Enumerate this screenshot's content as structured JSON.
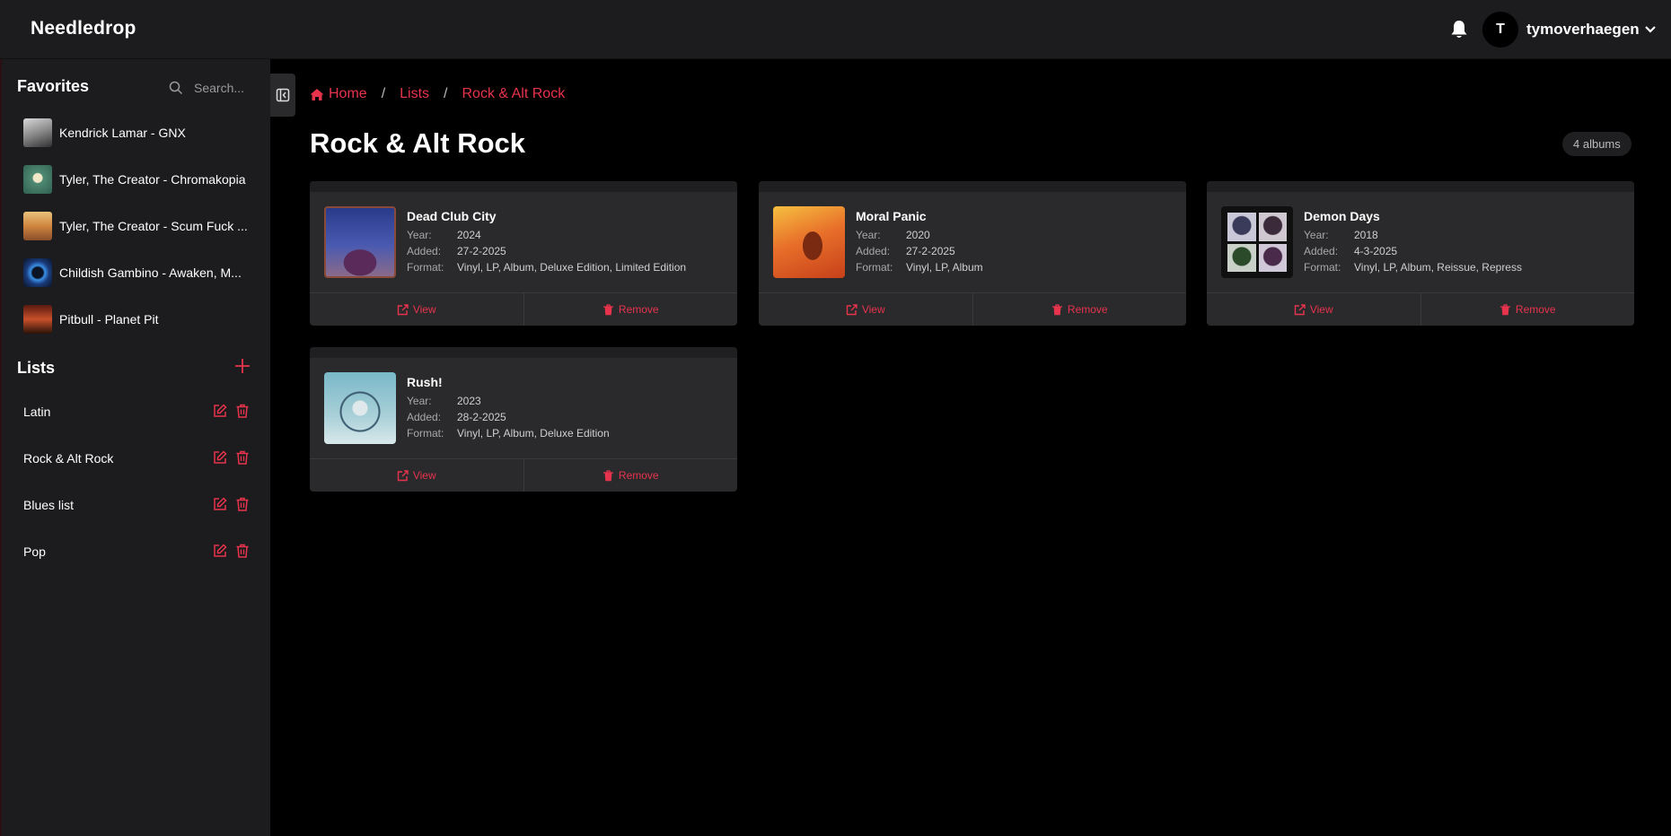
{
  "app": {
    "name": "Needledrop"
  },
  "header": {
    "user_initial": "T",
    "username": "tymoverhaegen"
  },
  "sidebar": {
    "favorites_title": "Favorites",
    "search_placeholder": "Search...",
    "favorites": [
      {
        "label": "Kendrick Lamar - GNX"
      },
      {
        "label": "Tyler, The Creator - Chromakopia"
      },
      {
        "label": "Tyler, The Creator - Scum Fuck ..."
      },
      {
        "label": "Childish Gambino - Awaken, M..."
      },
      {
        "label": "Pitbull - Planet Pit"
      }
    ],
    "lists_title": "Lists",
    "lists": [
      {
        "label": "Latin"
      },
      {
        "label": "Rock & Alt Rock"
      },
      {
        "label": "Blues list"
      },
      {
        "label": "Pop"
      }
    ]
  },
  "breadcrumb": {
    "home": "Home",
    "lists": "Lists",
    "current": "Rock & Alt Rock",
    "separator": "/"
  },
  "page": {
    "title": "Rock & Alt Rock",
    "count": "4 albums"
  },
  "labels": {
    "year": "Year:",
    "added": "Added:",
    "format": "Format:",
    "view": "View",
    "remove": "Remove"
  },
  "albums": [
    {
      "title": "Dead Club City",
      "year": "2024",
      "added": "27-2-2025",
      "format": "Vinyl, LP, Album, Deluxe Edition, Limited Edition"
    },
    {
      "title": "Moral Panic",
      "year": "2020",
      "added": "27-2-2025",
      "format": "Vinyl, LP, Album"
    },
    {
      "title": "Demon Days",
      "year": "2018",
      "added": "4-3-2025",
      "format": "Vinyl, LP, Album, Reissue, Repress"
    },
    {
      "title": "Rush!",
      "year": "2023",
      "added": "28-2-2025",
      "format": "Vinyl, LP, Album, Deluxe Edition"
    }
  ],
  "colors": {
    "accent": "#e8334d",
    "background": "#000000",
    "panel": "#1c1c1e",
    "card": "#2a2a2c"
  }
}
